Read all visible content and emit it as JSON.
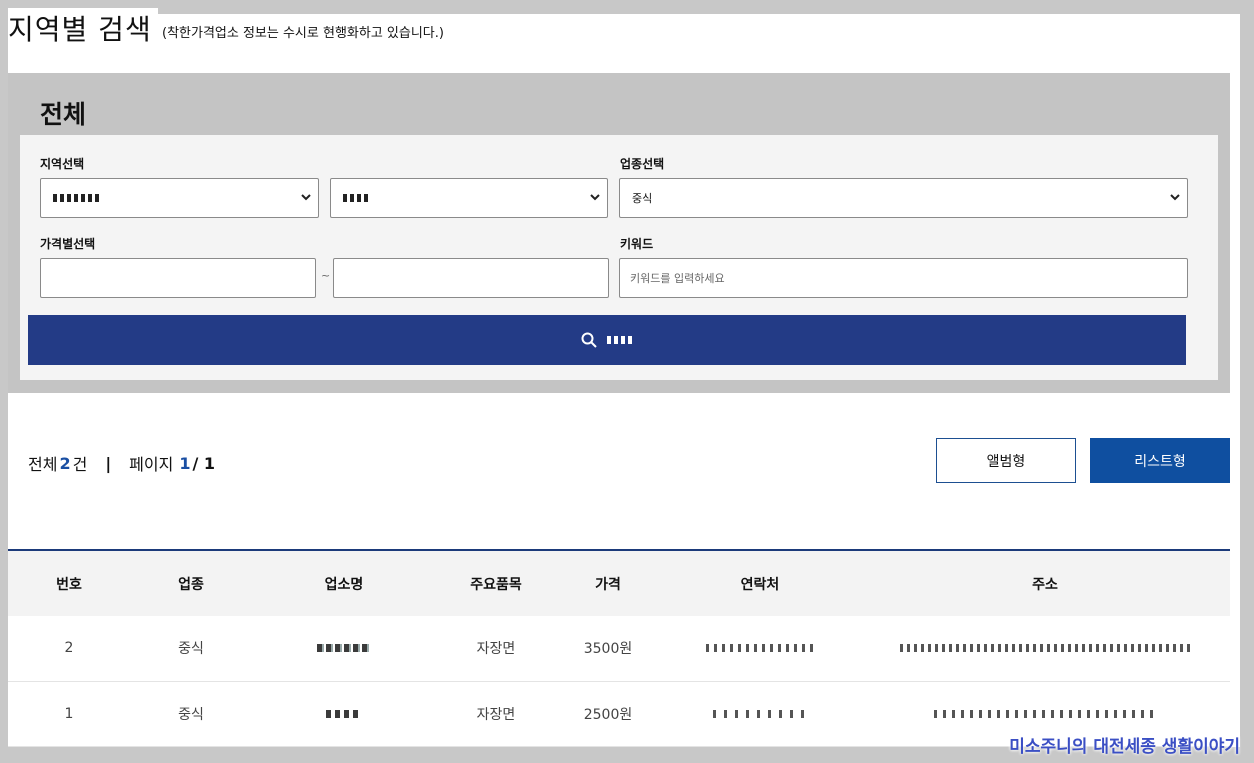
{
  "page": {
    "title": "지역별 검색",
    "note": "(착한가격업소 정보는 수시로 현행화하고 있습니다.)"
  },
  "search": {
    "heading": "전체",
    "region_label": "지역선택",
    "category_label": "업종선택",
    "category_value": "중식",
    "price_label": "가격별선택",
    "price_separator": "~",
    "keyword_label": "키워드",
    "keyword_placeholder": "키워드를 입력하세요",
    "button_icon": "search-icon"
  },
  "results": {
    "total_label": "전체",
    "total_count": "2",
    "total_unit": "건",
    "separator": "|",
    "page_label": "페이지",
    "page_current": "1",
    "page_total": "/ 1",
    "album_view_label": "앨범형",
    "list_view_label": "리스트형"
  },
  "table": {
    "headers": [
      "번호",
      "업종",
      "업소명",
      "주요품목",
      "가격",
      "연락처",
      "주소"
    ],
    "rows": [
      {
        "no": "2",
        "category": "중식",
        "item": "자장면",
        "price": "3500원"
      },
      {
        "no": "1",
        "category": "중식",
        "item": "자장면",
        "price": "2500원"
      }
    ]
  },
  "watermark": "미소주니의 대전세종 생활이야기",
  "colors": {
    "navy": "#233b86",
    "blue": "#0f4fa0",
    "count": "#1a4fa3"
  }
}
